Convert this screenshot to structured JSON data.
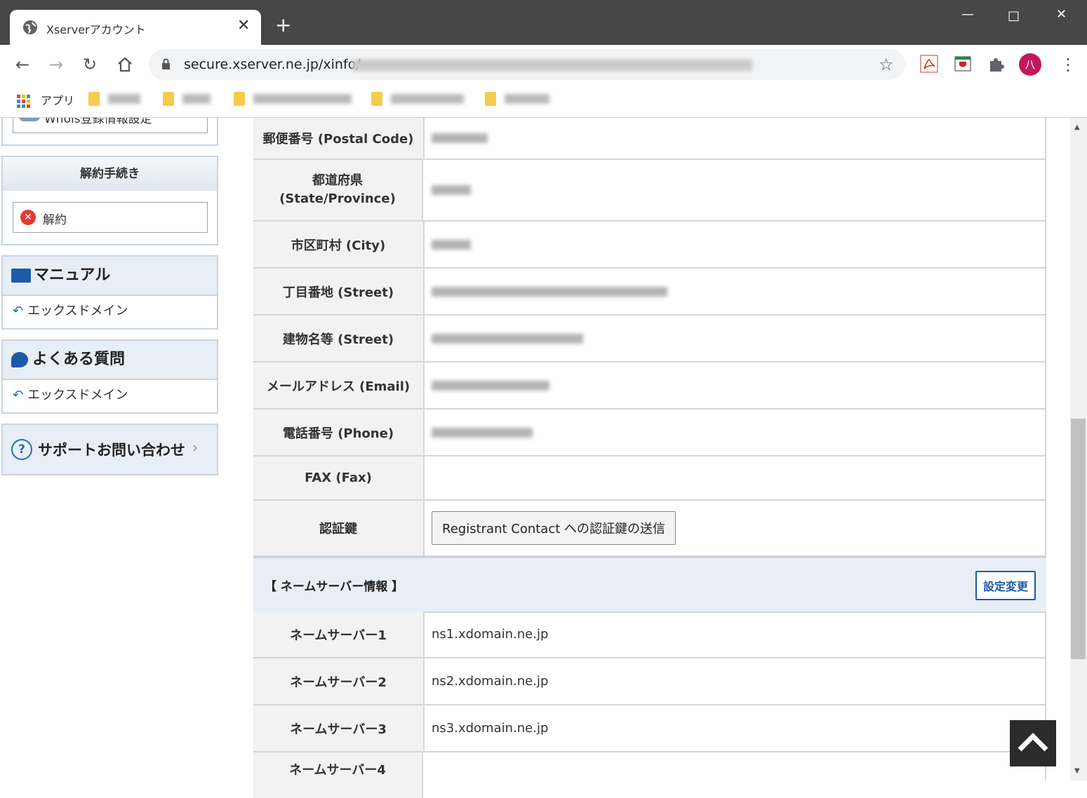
{
  "browser": {
    "tab_title": "Xserverアカウント",
    "tab_close": "✕",
    "new_tab": "+",
    "url": "secure.xserver.ne.jp/xinfo/",
    "avatar_initial": "八",
    "bookmarks": [
      {
        "label": "アプリ"
      }
    ]
  },
  "sidebar": {
    "whois_button": "Whois登録情報設定",
    "cancel_section_title": "解約手続き",
    "cancel_button": "解約",
    "manual_title": "マニュアル",
    "manual_item": "エックスドメイン",
    "faq_title": "よくある質問",
    "faq_item": "エックスドメイン",
    "support_title": "サポートお問い合わせ"
  },
  "contact": {
    "postal_label": "郵便番号 (Postal Code)",
    "state_label": "都道府県 (State/Province)",
    "city_label": "市区町村 (City)",
    "street1_label": "丁目番地 (Street)",
    "street2_label": "建物名等 (Street)",
    "email_label": "メールアドレス (Email)",
    "phone_label": "電話番号 (Phone)",
    "fax_label": "FAX (Fax)",
    "auth_label": "認証鍵",
    "auth_button": "Registrant Contact への認証鍵の送信"
  },
  "nameservers": {
    "section_title": "【 ネームサーバー情報 】",
    "edit_button": "設定変更",
    "rows": [
      {
        "label": "ネームサーバー1",
        "value": "ns1.xdomain.ne.jp"
      },
      {
        "label": "ネームサーバー2",
        "value": "ns2.xdomain.ne.jp"
      },
      {
        "label": "ネームサーバー3",
        "value": "ns3.xdomain.ne.jp"
      },
      {
        "label": "ネームサーバー4",
        "value": ""
      }
    ]
  }
}
